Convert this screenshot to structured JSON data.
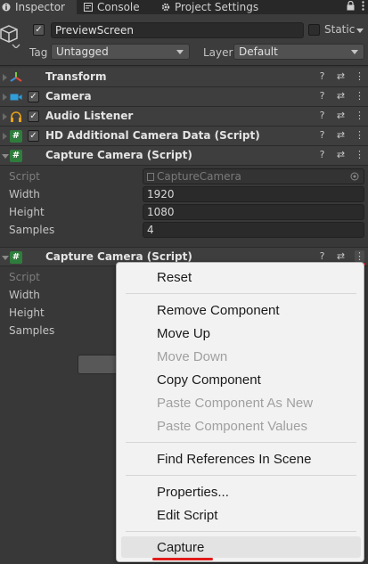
{
  "tabs": [
    {
      "label": "Inspector",
      "icon": "info-icon"
    },
    {
      "label": "Console",
      "icon": "console-icon"
    },
    {
      "label": "Project Settings",
      "icon": "gear-icon"
    }
  ],
  "header": {
    "object_name": "PreviewScreen",
    "static_label": "Static",
    "tag_label": "Tag",
    "tag_value": "Untagged",
    "layer_label": "Layer",
    "layer_value": "Default"
  },
  "components": [
    {
      "title": "Transform",
      "icon": "transform-icon",
      "has_checkbox": false
    },
    {
      "title": "Camera",
      "icon": "camera-icon",
      "has_checkbox": true
    },
    {
      "title": "Audio Listener",
      "icon": "headphones-icon",
      "has_checkbox": true
    },
    {
      "title": "HD Additional Camera Data (Script)",
      "icon": "script-icon",
      "has_checkbox": true
    },
    {
      "title": "Capture Camera (Script)",
      "icon": "script-icon",
      "has_checkbox": false
    },
    {
      "title": "Capture Camera (Script)",
      "icon": "script-icon",
      "has_checkbox": false
    }
  ],
  "capture1": {
    "script_label": "Script",
    "script_value": "CaptureCamera",
    "width_label": "Width",
    "width_value": "1920",
    "height_label": "Height",
    "height_value": "1080",
    "samples_label": "Samples",
    "samples_value": "4"
  },
  "capture2": {
    "script_label": "Script",
    "width_label": "Width",
    "height_label": "Height",
    "samples_label": "Samples"
  },
  "context_menu": {
    "items": [
      {
        "label": "Reset",
        "enabled": true
      },
      {
        "label": "Remove Component",
        "enabled": true
      },
      {
        "label": "Move Up",
        "enabled": true
      },
      {
        "label": "Move Down",
        "enabled": false
      },
      {
        "label": "Copy Component",
        "enabled": true
      },
      {
        "label": "Paste Component As New",
        "enabled": false
      },
      {
        "label": "Paste Component Values",
        "enabled": false
      },
      {
        "label": "Find References In Scene",
        "enabled": true
      },
      {
        "label": "Properties...",
        "enabled": true
      },
      {
        "label": "Edit Script",
        "enabled": true
      },
      {
        "label": "Capture",
        "enabled": true,
        "highlighted": true
      }
    ]
  },
  "colors": {
    "annotation_red": "#e21a1a",
    "script_green": "#2f7d3c"
  }
}
